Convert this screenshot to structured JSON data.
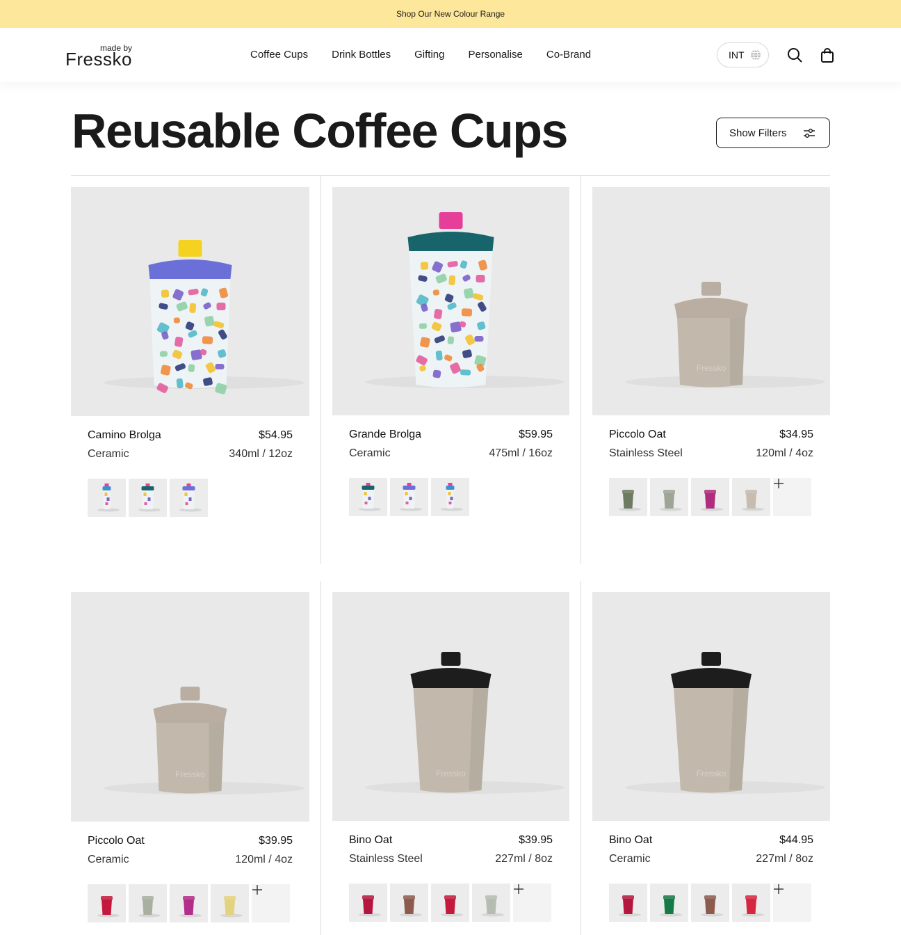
{
  "announcement": "Shop Our New Colour Range",
  "header": {
    "logo_small": "made by",
    "logo_brand": "Fressko",
    "nav": [
      "Coffee Cups",
      "Drink Bottles",
      "Gifting",
      "Personalise",
      "Co-Brand"
    ],
    "region": "INT"
  },
  "page": {
    "title": "Reusable Coffee Cups",
    "filters_label": "Show Filters"
  },
  "products": [
    {
      "name": "Camino Brolga",
      "price": "$54.95",
      "material": "Ceramic",
      "size": "340ml / 12oz",
      "swatches": [
        "pattern-slim",
        "pattern-teal",
        "pattern-blue"
      ],
      "more": false
    },
    {
      "name": "Grande Brolga",
      "price": "$59.95",
      "material": "Ceramic",
      "size": "475ml / 16oz",
      "swatches": [
        "pattern-teal",
        "pattern-blue",
        "pattern-slim"
      ],
      "more": false
    },
    {
      "name": "Piccolo Oat",
      "price": "$34.95",
      "material": "Stainless Steel",
      "size": "120ml / 4oz",
      "swatches": [
        "#6f7a62",
        "#9da595",
        "#b02c7c",
        "#c7bcae"
      ],
      "more": true
    },
    {
      "name": "Piccolo Oat",
      "price": "$39.95",
      "material": "Ceramic",
      "size": "120ml / 4oz",
      "swatches": [
        "#c4193d",
        "#a8b09f",
        "#b32d8a",
        "#e4d37e"
      ],
      "more": true
    },
    {
      "name": "Bino Oat",
      "price": "$39.95",
      "material": "Stainless Steel",
      "size": "227ml / 8oz",
      "swatches": [
        "#b5163d",
        "#8d5a4e",
        "#c4193d",
        "#b5bdb0"
      ],
      "more": true
    },
    {
      "name": "Bino Oat",
      "price": "$44.95",
      "material": "Ceramic",
      "size": "227ml / 8oz",
      "swatches": [
        "#b5163d",
        "#157a45",
        "#8d5a4e",
        "#d7263f"
      ],
      "more": true
    }
  ]
}
